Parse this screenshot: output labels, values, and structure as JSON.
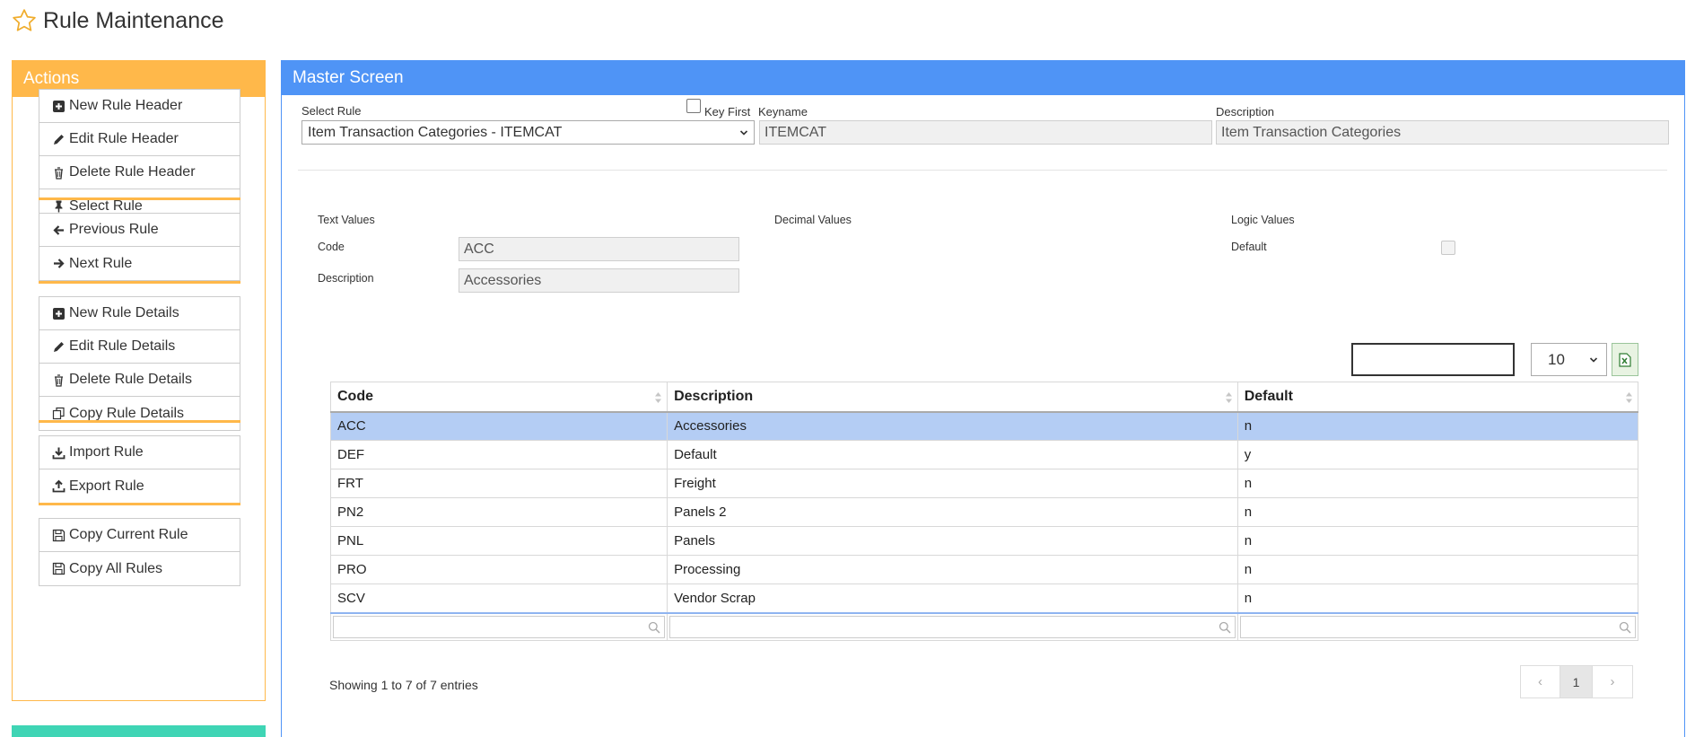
{
  "page": {
    "title": "Rule Maintenance"
  },
  "actions": {
    "title": "Actions",
    "groups": [
      [
        {
          "label": "New Rule Header",
          "icon": "plus-square-icon"
        },
        {
          "label": "Edit Rule Header",
          "icon": "pencil-icon"
        },
        {
          "label": "Delete Rule Header",
          "icon": "trash-icon"
        },
        {
          "label": "Select Rule",
          "icon": "pushpin-icon"
        }
      ],
      [
        {
          "label": "Previous Rule",
          "icon": "arrow-left-icon"
        },
        {
          "label": "Next Rule",
          "icon": "arrow-right-icon"
        }
      ],
      [
        {
          "label": "New Rule Details",
          "icon": "plus-square-icon"
        },
        {
          "label": "Edit Rule Details",
          "icon": "pencil-icon"
        },
        {
          "label": "Delete Rule Details",
          "icon": "trash-icon"
        },
        {
          "label": "Copy Rule Details",
          "icon": "copy-icon"
        }
      ],
      [
        {
          "label": "Import Rule",
          "icon": "download-icon"
        },
        {
          "label": "Export Rule",
          "icon": "upload-icon"
        }
      ],
      [
        {
          "label": "Copy Current Rule",
          "icon": "save-icon"
        },
        {
          "label": "Copy All Rules",
          "icon": "save-icon"
        }
      ]
    ]
  },
  "master": {
    "title": "Master Screen",
    "select_rule_label": "Select Rule",
    "select_rule_value": "Item Transaction Categories - ITEMCAT",
    "key_first_label": "Key First",
    "keyname_label": "Keyname",
    "keyname_value": "ITEMCAT",
    "description_label": "Description",
    "description_value": "Item Transaction Categories",
    "text_values_label": "Text Values",
    "decimal_values_label": "Decimal Values",
    "logic_values_label": "Logic Values",
    "code_label": "Code",
    "code_value": "ACC",
    "detail_description_label": "Description",
    "detail_description_value": "Accessories",
    "default_label": "Default"
  },
  "table": {
    "page_length": "10",
    "columns": [
      "Code",
      "Description",
      "Default"
    ],
    "rows": [
      [
        "ACC",
        "Accessories",
        "n"
      ],
      [
        "DEF",
        "Default",
        "y"
      ],
      [
        "FRT",
        "Freight",
        "n"
      ],
      [
        "PN2",
        "Panels 2",
        "n"
      ],
      [
        "PNL",
        "Panels",
        "n"
      ],
      [
        "PRO",
        "Processing",
        "n"
      ],
      [
        "SCV",
        "Vendor Scrap",
        "n"
      ]
    ],
    "selected_row": 0,
    "info": "Showing 1 to 7 of 7 entries",
    "pagination": {
      "prev": "‹",
      "current": "1",
      "next": "›"
    }
  },
  "colors": {
    "actions_accent": "#ffb84a",
    "master_accent": "#4f94f6",
    "selected_row": "#b4cdf4",
    "teal_panel": "#3fd5b5"
  }
}
